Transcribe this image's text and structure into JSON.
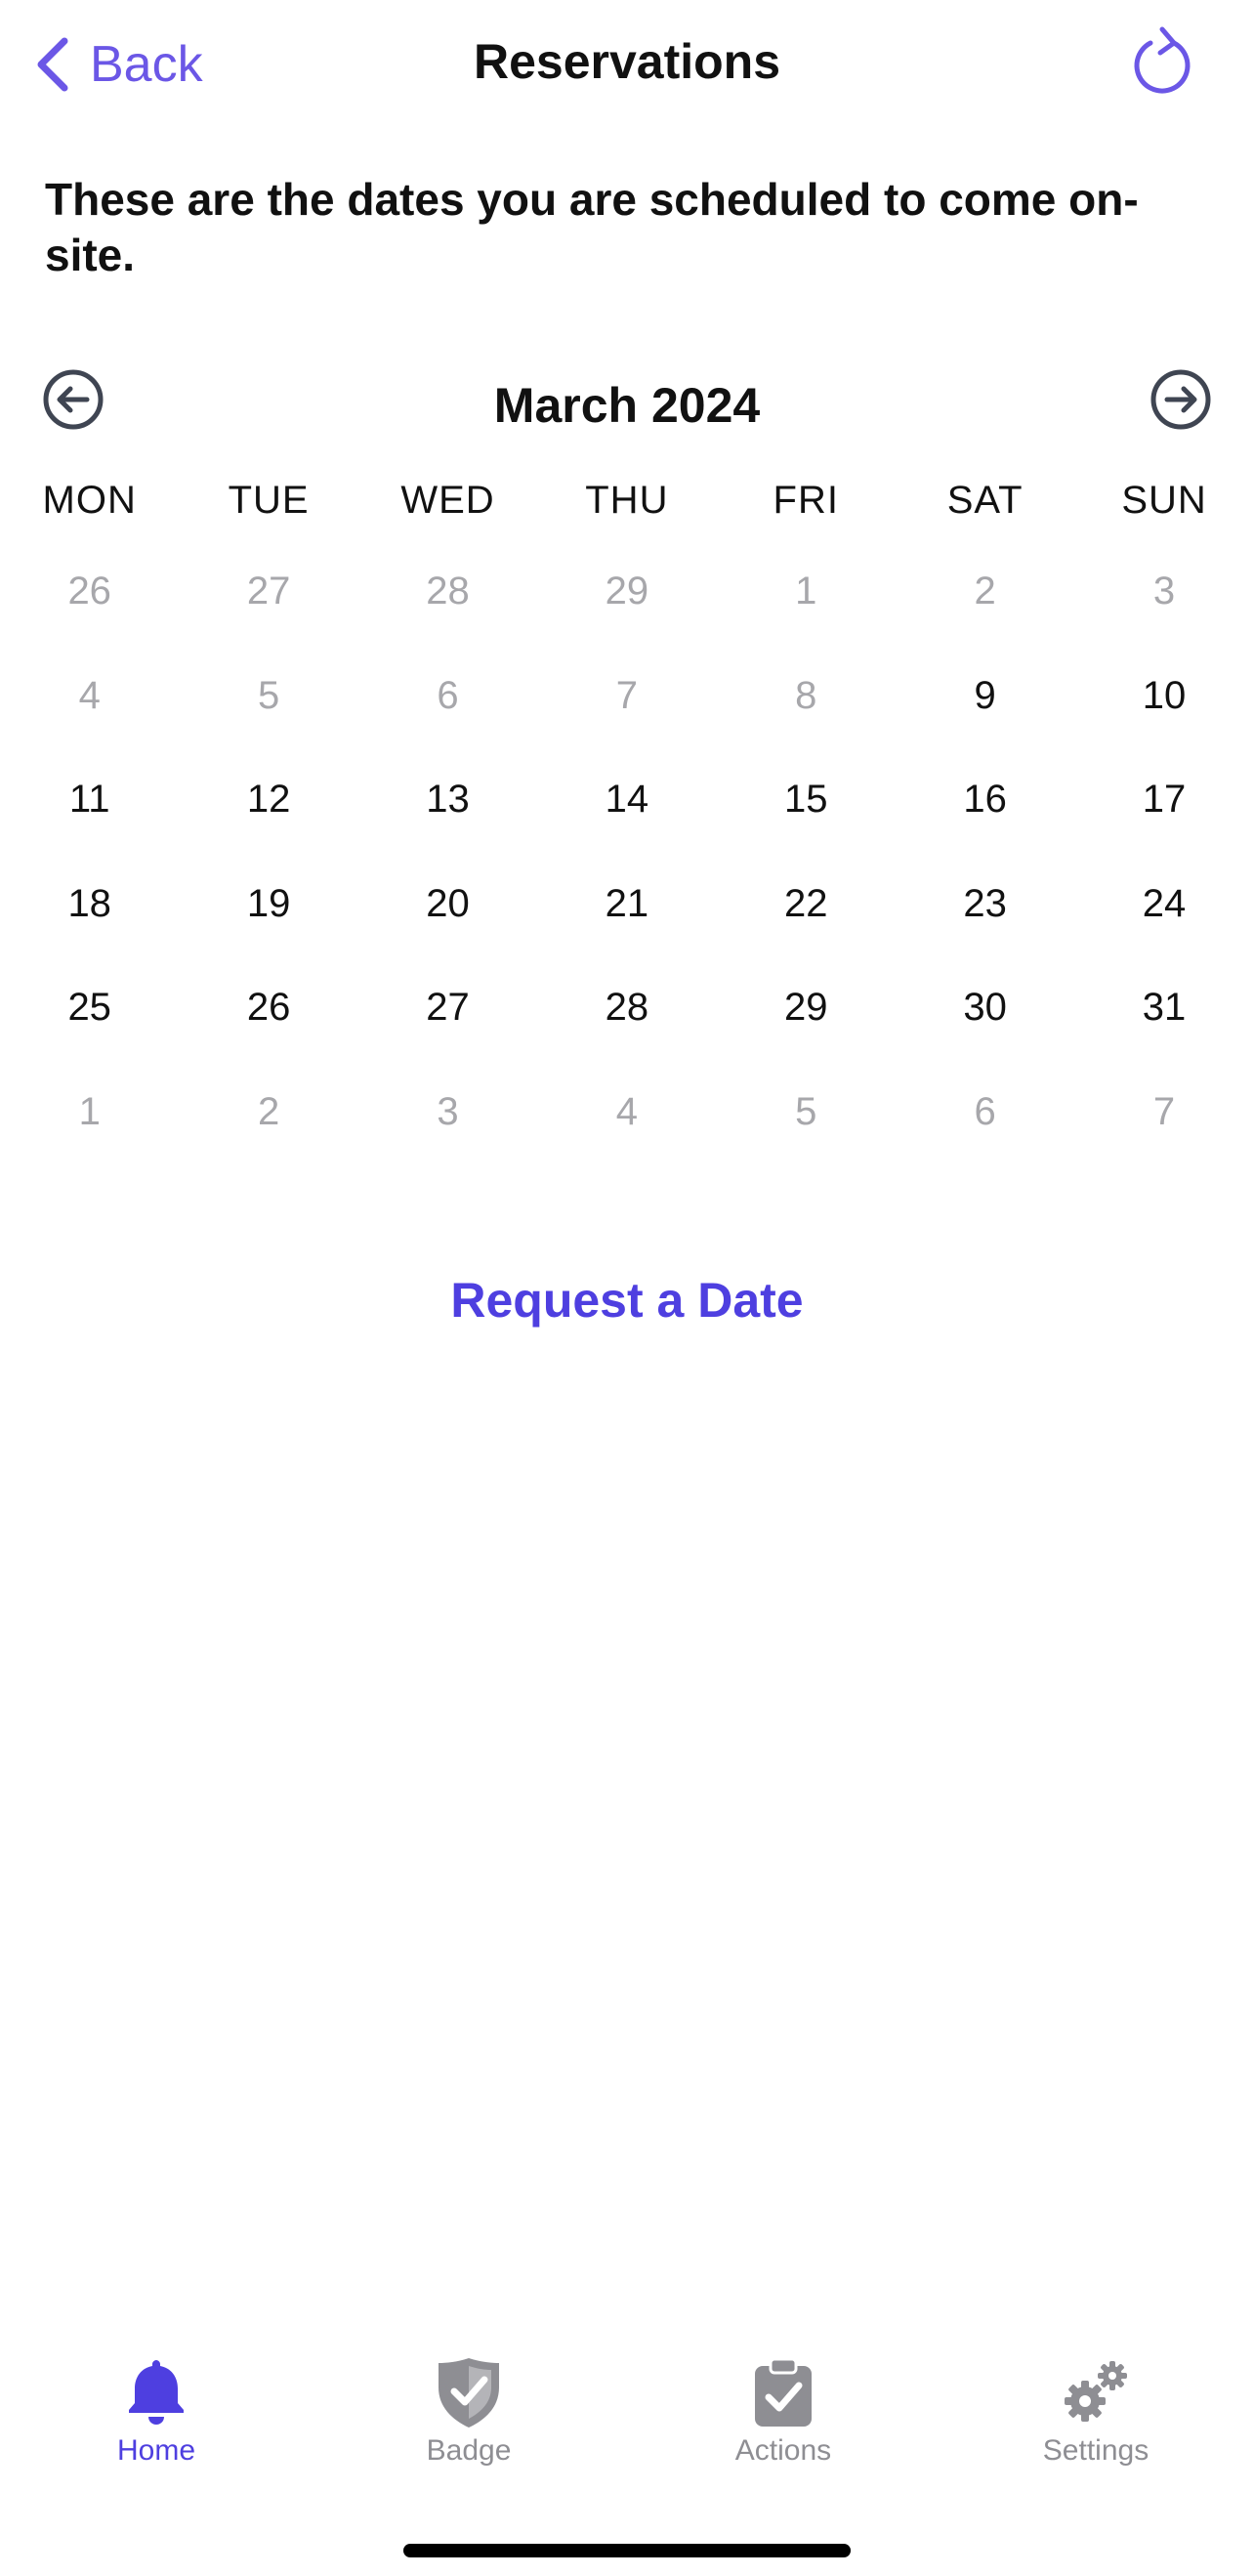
{
  "header": {
    "back_label": "Back",
    "title": "Reservations",
    "refresh_icon": "refresh-icon"
  },
  "intro": {
    "text": "These are the dates you are scheduled to come on-site."
  },
  "calendar": {
    "month_label": "March 2024",
    "prev_icon": "arrow-left-circle-icon",
    "next_icon": "arrow-right-circle-icon",
    "weekdays": [
      "MON",
      "TUE",
      "WED",
      "THU",
      "FRI",
      "SAT",
      "SUN"
    ],
    "weeks": [
      [
        "26",
        "27",
        "28",
        "29",
        "1",
        "2",
        "3"
      ],
      [
        "4",
        "5",
        "6",
        "7",
        "8",
        "9",
        "10"
      ],
      [
        "11",
        "12",
        "13",
        "14",
        "15",
        "16",
        "17"
      ],
      [
        "18",
        "19",
        "20",
        "21",
        "22",
        "23",
        "24"
      ],
      [
        "25",
        "26",
        "27",
        "28",
        "29",
        "30",
        "31"
      ],
      [
        "1",
        "2",
        "3",
        "4",
        "5",
        "6",
        "7"
      ]
    ],
    "muted": [
      [
        true,
        true,
        true,
        true,
        true,
        true,
        true
      ],
      [
        true,
        true,
        true,
        true,
        true,
        false,
        false
      ],
      [
        false,
        false,
        false,
        false,
        false,
        false,
        false
      ],
      [
        false,
        false,
        false,
        false,
        false,
        false,
        false
      ],
      [
        false,
        false,
        false,
        false,
        false,
        false,
        false
      ],
      [
        true,
        true,
        true,
        true,
        true,
        true,
        true
      ]
    ]
  },
  "request_button": {
    "label": "Request a Date"
  },
  "tabbar": {
    "tabs": [
      {
        "label": "Home",
        "icon": "bell-icon",
        "active": true
      },
      {
        "label": "Badge",
        "icon": "shield-check-icon",
        "active": false
      },
      {
        "label": "Actions",
        "icon": "clipboard-check-icon",
        "active": false
      },
      {
        "label": "Settings",
        "icon": "gears-icon",
        "active": false
      }
    ]
  },
  "colors": {
    "accent": "#4e3fe0",
    "back_accent": "#6b57e6",
    "muted_text": "#a7a7ab",
    "inactive_tab": "#8e8e93",
    "nav_icon": "#3f4552"
  }
}
